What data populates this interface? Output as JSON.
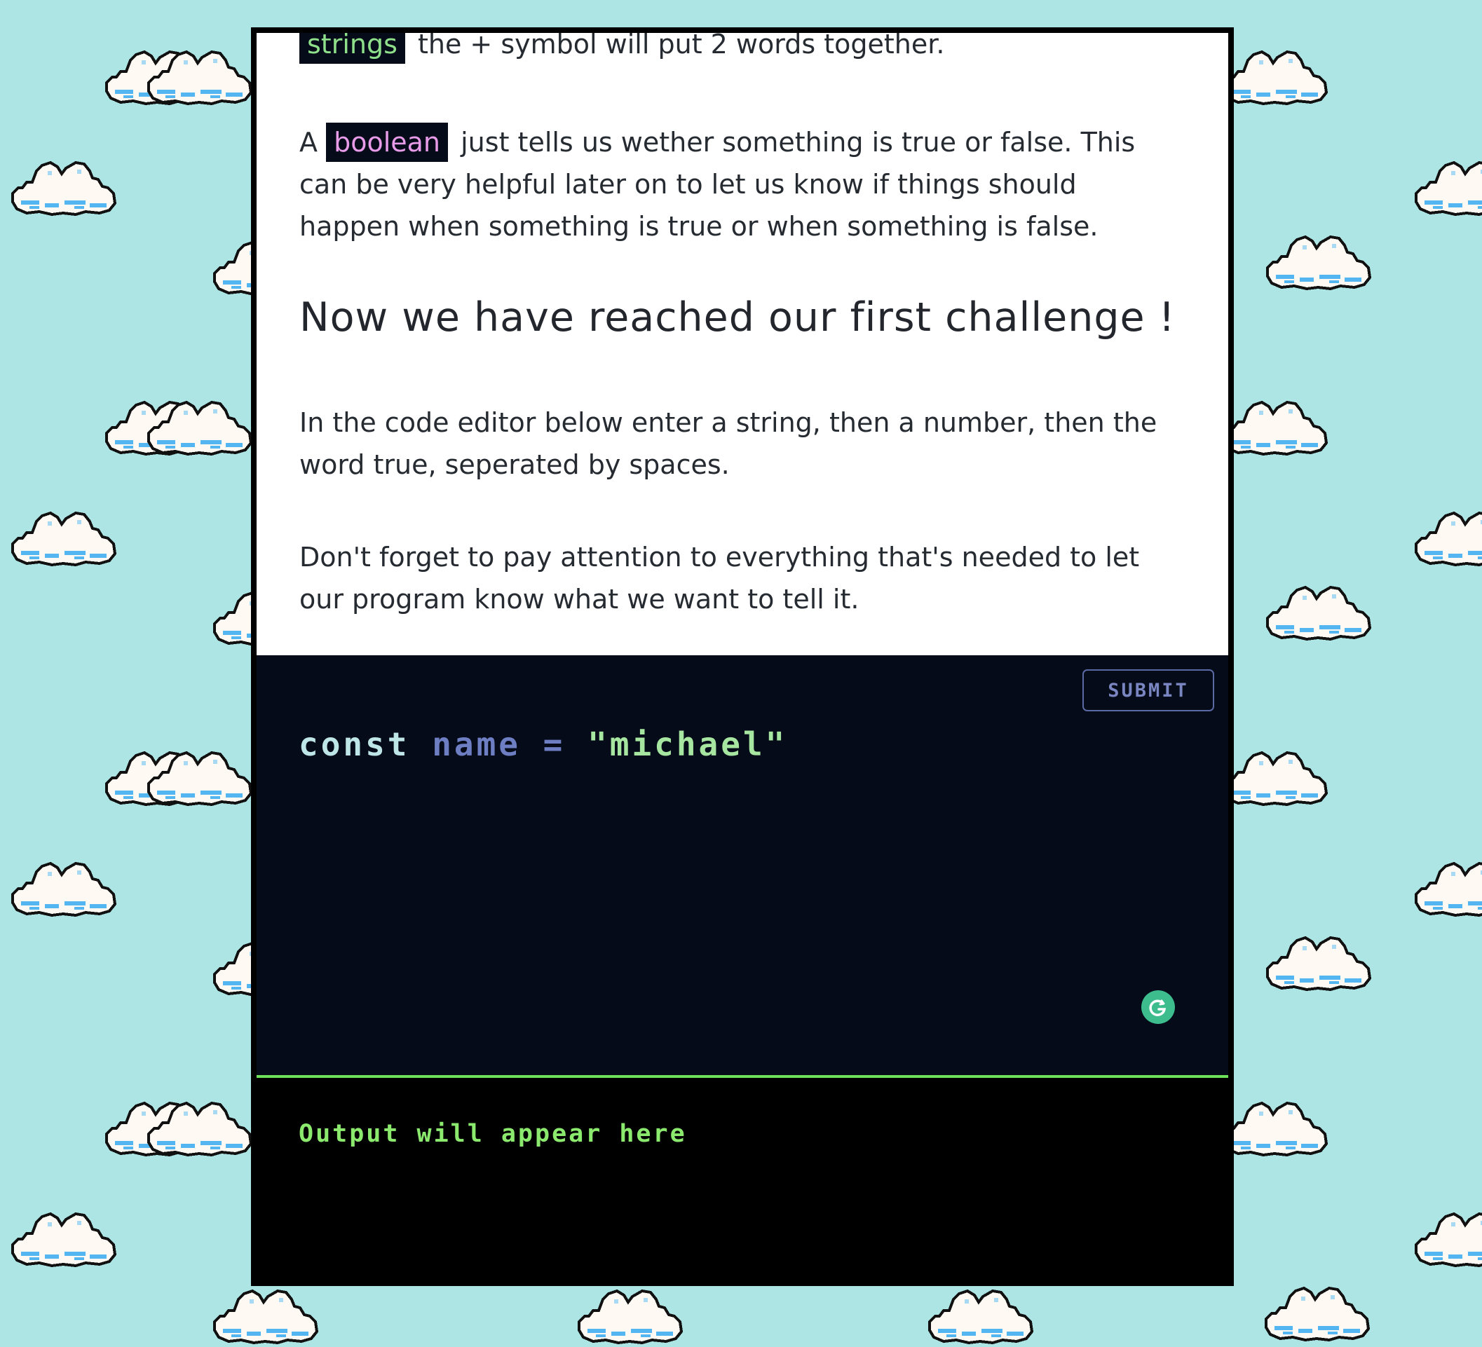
{
  "background": {
    "color": "#ade4e4",
    "pattern": "pixel-cloud"
  },
  "lesson": {
    "strings_tag": "strings",
    "strings_sentence": "the + symbol will put 2 words together.",
    "boolean_prefix": "A",
    "boolean_tag": "boolean",
    "boolean_sentence": "just tells us wether something is true or false. This can be very helpful later on to let us know if things should happen when something is true or when something is false.",
    "challenge_heading": "Now we have reached our first challenge !",
    "instruction": "In the code editor below enter a string, then a number, then the word true, seperated by spaces.",
    "reminder": "Don't forget to pay attention to everything that's needed to let our program know what we want to tell it."
  },
  "editor": {
    "submit_label": "SUBMIT",
    "code": {
      "keyword": "const",
      "identifier": "name",
      "operator": "=",
      "string": "\"michael\""
    },
    "grammarly_icon": "G"
  },
  "output": {
    "placeholder": "Output will appear here"
  },
  "colors": {
    "code_background": "#050b18",
    "string_color": "#a6e6a0",
    "boolean_color": "#e79be8",
    "identifier_color": "#6e7ec3",
    "output_color": "#8bea6e",
    "divider_color": "#6ee05a",
    "grammarly_color": "#3dbd8e"
  }
}
